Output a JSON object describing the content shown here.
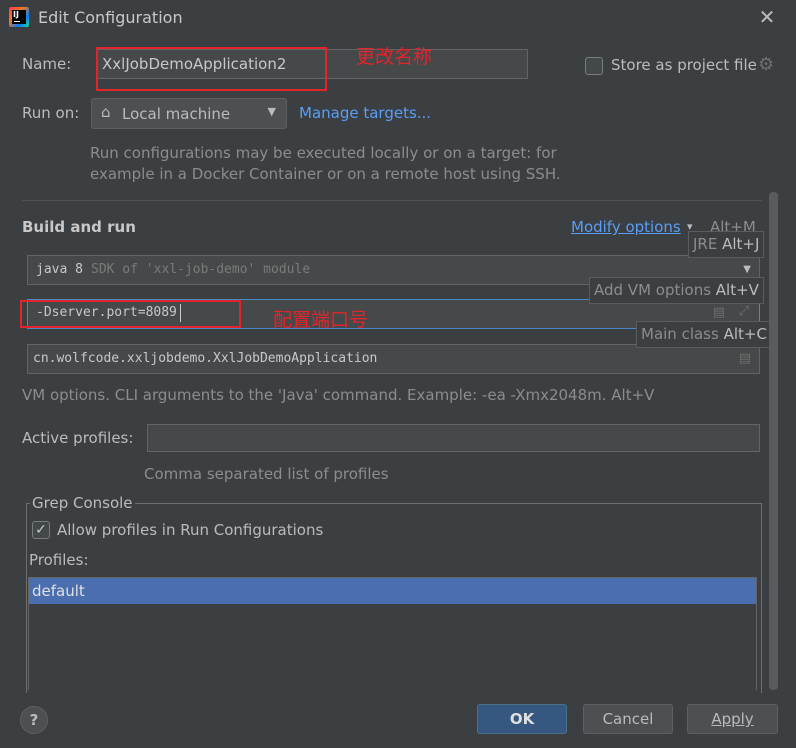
{
  "window": {
    "title": "Edit Configuration"
  },
  "name_row": {
    "label": "Name:",
    "value": "XxlJobDemoApplication2",
    "annotation": "更改名称"
  },
  "store": {
    "label": "Store as project file",
    "checked": false
  },
  "run_on": {
    "label": "Run on:",
    "value": "Local machine",
    "manage_link": "Manage targets...",
    "hint_line1": "Run configurations may be executed locally or on a target: for",
    "hint_line2": "example in a Docker Container or on a remote host using SSH."
  },
  "build_run": {
    "heading": "Build and run",
    "modify_options": "Modify options",
    "modify_shortcut": "Alt+M",
    "jdk_value": "java 8",
    "jdk_hint": "SDK of 'xxl-job-demo' module",
    "vm_options_value": "-Dserver.port=8089",
    "vm_annotation": "配置端口号",
    "main_class_value": "cn.wolfcode.xxljobdemo.XxlJobDemoApplication",
    "vm_hint": "VM options. CLI arguments to the 'Java' command. Example: -ea -Xmx2048m. Alt+V"
  },
  "popups": {
    "jre": {
      "text": "JRE ",
      "key": "Alt+J"
    },
    "vm": {
      "text": "Add VM options ",
      "key": "Alt+V"
    },
    "main": {
      "text": "Main class ",
      "key": "Alt+C"
    }
  },
  "profiles": {
    "label": "Active profiles:",
    "value": "",
    "hint": "Comma separated list of profiles"
  },
  "grep": {
    "legend": "Grep Console",
    "allow_label": "Allow profiles in Run Configurations",
    "allow_checked": true,
    "profiles_label": "Profiles:",
    "items": [
      "default"
    ]
  },
  "footer": {
    "help": "?",
    "ok": "OK",
    "cancel": "Cancel",
    "apply": "Apply"
  },
  "colors": {
    "accent": "#365880",
    "link": "#589df6",
    "annotation_red": "#e5232a",
    "selection": "#4b6eaf"
  }
}
